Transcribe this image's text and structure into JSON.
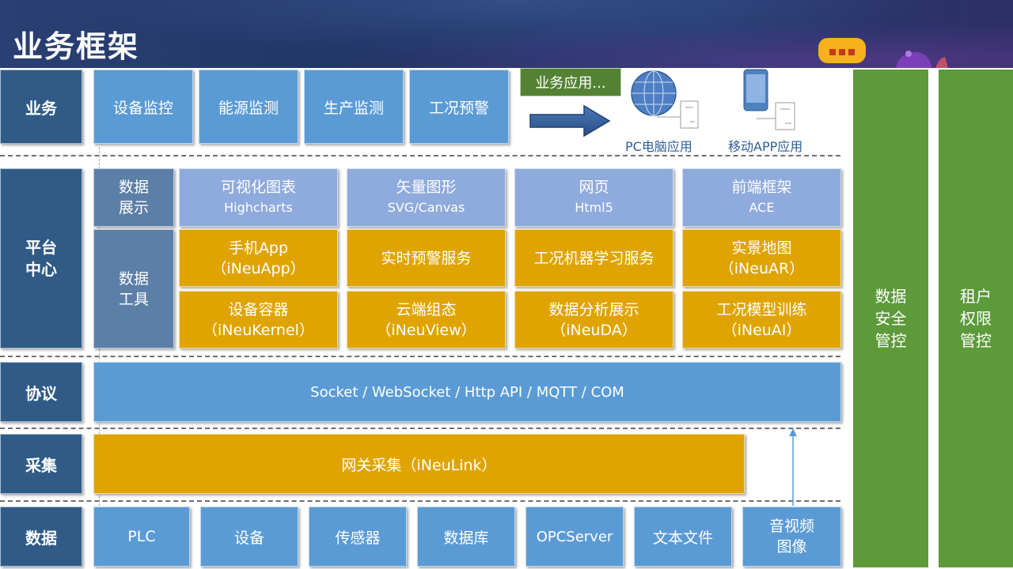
{
  "header": {
    "title": "业务框架"
  },
  "layers": {
    "business": "业务",
    "platform": "平台\n中心",
    "protocol": "协议",
    "collect": "采集",
    "data": "数据"
  },
  "business": {
    "items": [
      "设备监控",
      "能源监测",
      "生产监测",
      "工况预警"
    ],
    "app_banner": "业务应用...",
    "pc_label": "PC电脑应用",
    "mobile_label": "移动APP应用"
  },
  "platform": {
    "display_label": "数据\n展示",
    "tools_label": "数据\n工具",
    "display_items": [
      {
        "title": "可视化图表",
        "sub": "Highcharts"
      },
      {
        "title": "矢量图形",
        "sub": "SVG/Canvas"
      },
      {
        "title": "网页",
        "sub": "Html5"
      },
      {
        "title": "前端框架",
        "sub": "ACE"
      }
    ],
    "tool_row1": [
      {
        "title": "手机App",
        "sub": "（iNeuApp）"
      },
      {
        "title": "实时预警服务",
        "sub": ""
      },
      {
        "title": "工况机器学习服务",
        "sub": ""
      },
      {
        "title": "实景地图",
        "sub": "（iNeuAR）"
      }
    ],
    "tool_row2": [
      {
        "title": "设备容器",
        "sub": "（iNeuKernel）"
      },
      {
        "title": "云端组态",
        "sub": "（iNeuView）"
      },
      {
        "title": "数据分析展示",
        "sub": "（iNeuDA）"
      },
      {
        "title": "工况模型训练",
        "sub": "（iNeuAI）"
      }
    ]
  },
  "protocol": {
    "text": "Socket / WebSocket / Http API / MQTT / COM"
  },
  "collect": {
    "text": "网关采集（iNeuLink）"
  },
  "data": {
    "items": [
      "PLC",
      "设备",
      "传感器",
      "数据库",
      "OPCServer",
      "文本文件",
      "音视频\n图像"
    ]
  },
  "side": {
    "security": "数据\n安全\n管控",
    "tenant": "租户\n权限\n管控"
  },
  "colors": {
    "dark": "#2f5b86",
    "mid": "#5b9bd5",
    "light": "#8faadc",
    "gold": "#dfa400",
    "green": "#5c9a3a",
    "header": "#1f3566"
  }
}
